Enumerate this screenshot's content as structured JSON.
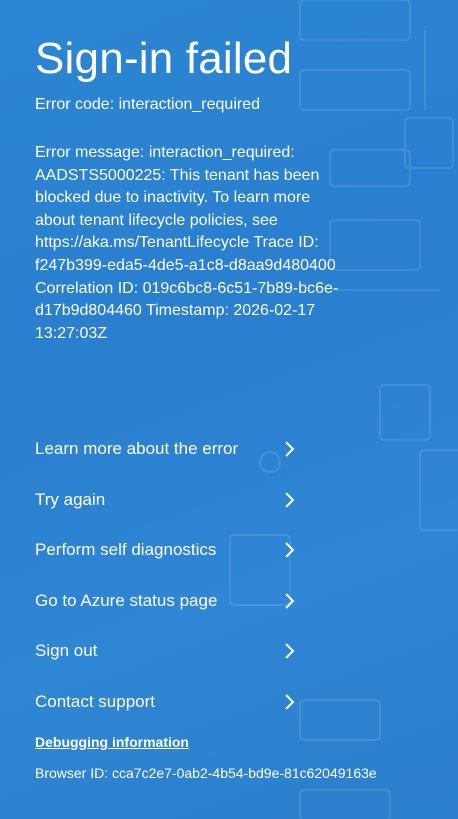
{
  "title": "Sign-in failed",
  "error_code": "Error code: interaction_required",
  "error_message": "Error message: interaction_required: AADSTS5000225: This tenant has been blocked due to inactivity. To learn more about tenant lifecycle policies, see https://aka.ms/TenantLifecycle Trace ID: f247b399-eda5-4de5-a1c8-d8aa9d480400 Correlation ID: 019c6bc8-6c51-7b89-bc6e-d17b9d804460 Timestamp: 2026-02-17 13:27:03Z",
  "actions": [
    {
      "label": "Learn more about the error",
      "icon": "chevron-right-icon"
    },
    {
      "label": "Try again",
      "icon": "chevron-right-icon"
    },
    {
      "label": "Perform self diagnostics",
      "icon": "chevron-right-icon"
    },
    {
      "label": "Go to Azure status page",
      "icon": "chevron-right-icon"
    },
    {
      "label": "Sign out",
      "icon": "chevron-right-icon"
    },
    {
      "label": "Contact support",
      "icon": "chevron-right-icon"
    }
  ],
  "debugging": {
    "link_label": "Debugging information",
    "browser_id": "Browser ID: cca7c2e7-0ab2-4b54-bd9e-81c62049163e"
  },
  "colors": {
    "background": "#2b82d0",
    "text": "#ffffff"
  }
}
